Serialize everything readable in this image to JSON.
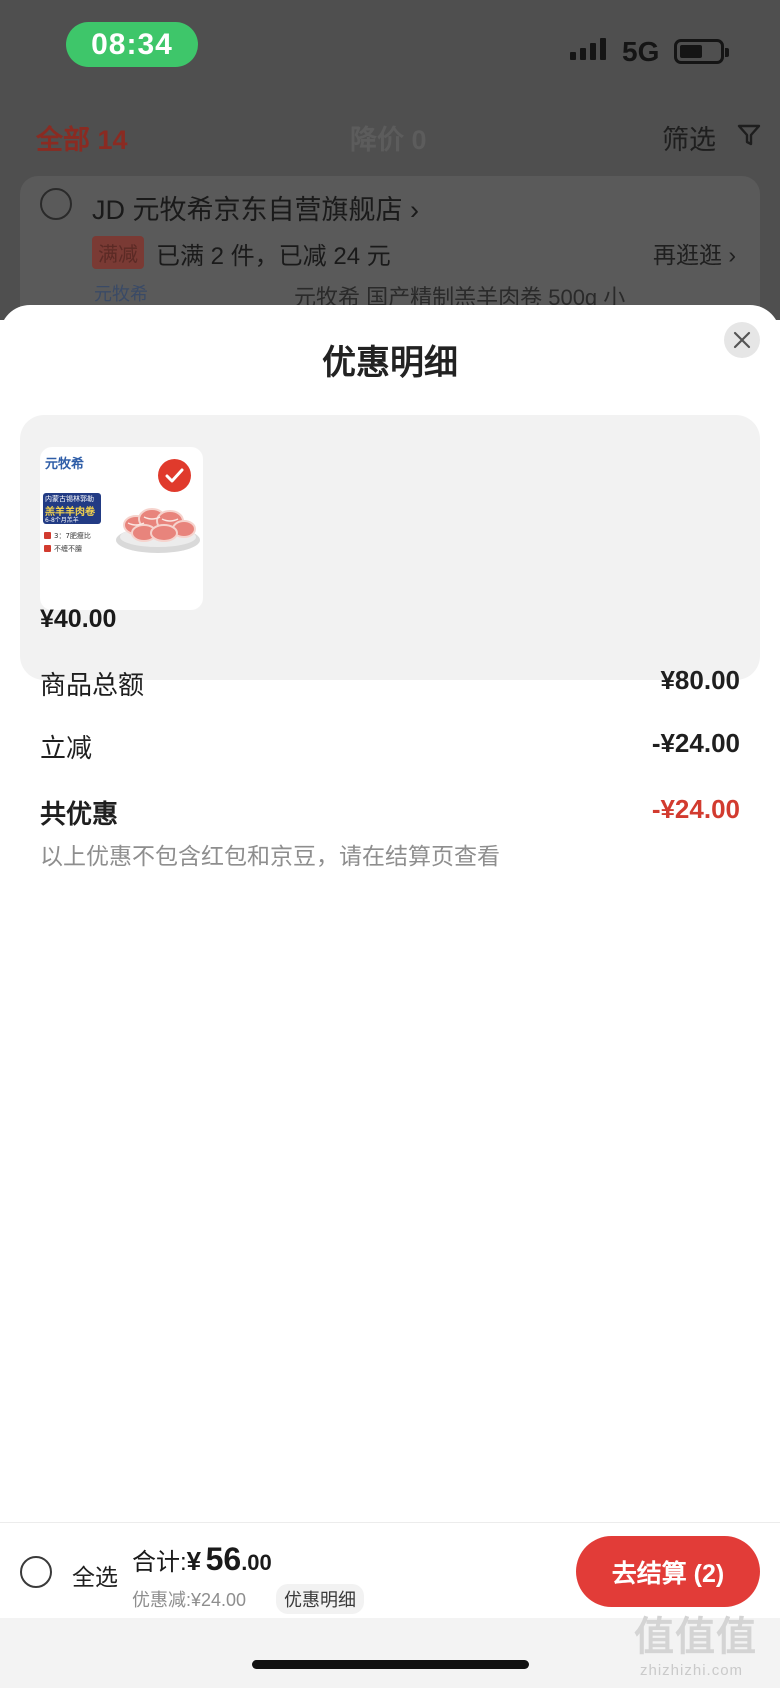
{
  "status_bar": {
    "time": "08:34",
    "network": "5G",
    "battery_level": 0.5,
    "signal_bars": 4
  },
  "cart_tabs": {
    "all_label": "全部 14",
    "price_drop_label": "降价 0",
    "filter_label": "筛选",
    "filter_icon": "funnel-icon"
  },
  "store": {
    "name": "JD 元牧希京东自营旗舰店 ›",
    "promo_tag": "满减",
    "promo_text": "已满 2 件，已减 24 元",
    "shop_more": "再逛逛 ›",
    "logo_peek": "元牧希",
    "product_title_peek": "元牧希 国产精制羔羊肉卷 500g 小"
  },
  "sheet": {
    "title": "优惠明细",
    "close_icon": "close-icon",
    "product": {
      "thumb_brand": "元牧希",
      "thumb_banner_line1": "内蒙古锡林郭勒",
      "thumb_banner_title": "羔羊羊肉卷",
      "thumb_banner_line3": "6-8个月羔羊",
      "thumb_point1": "3：7肥瘦比",
      "thumb_point2": "不缠不膻",
      "price": "¥40.00",
      "selected": true
    },
    "rows": {
      "subtotal_label": "商品总额",
      "subtotal_value": "¥80.00",
      "reduce_label": "立减",
      "reduce_value": "-¥24.00",
      "total_label": "共优惠",
      "total_value": "-¥24.00"
    },
    "note": "以上优惠不包含红包和京豆，请在结算页查看"
  },
  "bottom_bar": {
    "select_all": "全选",
    "total_label": "合计:",
    "total_currency": "¥",
    "total_int": "56",
    "total_dec": ".00",
    "discount_text": "优惠减:¥24.00",
    "detail_label": "优惠明细",
    "checkout_label": "去结算 (2)"
  },
  "watermark": {
    "chars": "值值值",
    "url": "zhizhizhi.com"
  },
  "colors": {
    "accent_red": "#e23c38",
    "discount_red": "#d23b2f",
    "time_pill_green": "#3ec66a",
    "dim_overlay": "#4f4f4f"
  }
}
